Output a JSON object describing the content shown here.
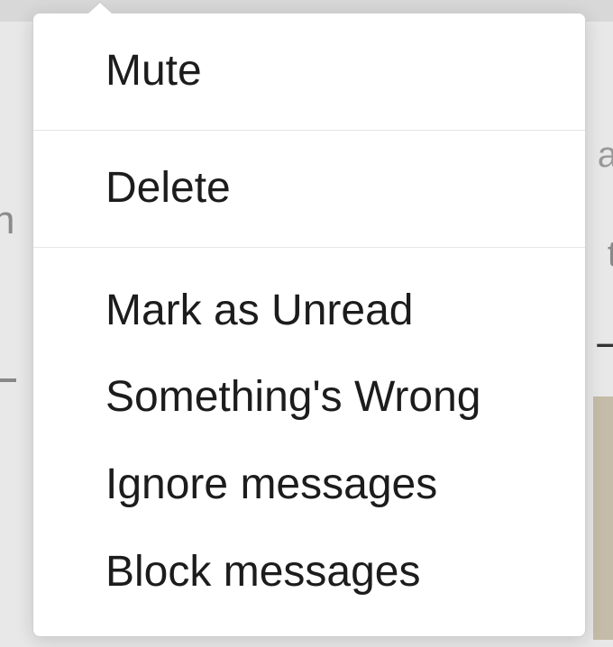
{
  "menu": {
    "sections": [
      {
        "items": [
          {
            "label": "Mute",
            "key": "mute"
          }
        ]
      },
      {
        "items": [
          {
            "label": "Delete",
            "key": "delete"
          }
        ]
      },
      {
        "items": [
          {
            "label": "Mark as Unread",
            "key": "mark-unread"
          },
          {
            "label": "Something's Wrong",
            "key": "somethings-wrong"
          },
          {
            "label": "Ignore messages",
            "key": "ignore-messages"
          },
          {
            "label": "Block messages",
            "key": "block-messages"
          }
        ]
      }
    ]
  }
}
